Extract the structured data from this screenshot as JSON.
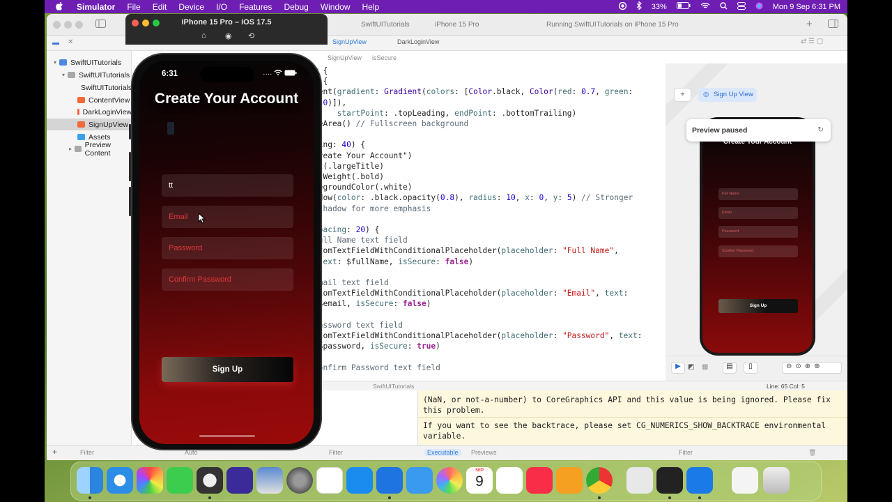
{
  "menubar": {
    "app": "Simulator",
    "items": [
      "File",
      "Edit",
      "Device",
      "I/O",
      "Features",
      "Debug",
      "Window",
      "Help"
    ],
    "battery": "33%",
    "datetime": "Mon 9 Sep  6:31 PM"
  },
  "simulator": {
    "title": "iPhone 15 Pro – iOS 17.5"
  },
  "xcode": {
    "status_project": "SwiftUITutorials",
    "status_device": "iPhone 15 Pro",
    "status_running": "Running SwiftUITutorials on iPhone 15 Pro",
    "tabs": [
      "SignUpView",
      "DarkLoginView"
    ],
    "breadcrumb": [
      "SignUpView",
      "isSecure"
    ],
    "navigator": [
      {
        "label": "SwiftUITutorials",
        "indent": 0
      },
      {
        "label": "SwiftUITutorials",
        "indent": 1
      },
      {
        "label": "SwiftUITutorials",
        "indent": 2
      },
      {
        "label": "ContentView",
        "indent": 2
      },
      {
        "label": "DarkLoginView",
        "indent": 2
      },
      {
        "label": "SignUpView",
        "indent": 2
      },
      {
        "label": "Assets",
        "indent": 2
      },
      {
        "label": "Preview Content",
        "indent": 2
      }
    ],
    "line_col": "Line: 65  Col: 5",
    "debug_target": "SwiftUITutorials",
    "filter_placeholder": "Filter",
    "console_tabs": [
      "Executable",
      "Previews"
    ],
    "zoom_label": "Auto"
  },
  "code_lines": [
    "w {",
    "y {",
    "ient(gradient: Gradient(colors: [Color.black, Color(red: 0.7, green:",
    ": 0)]),",
    "     startPoint: .topLeading, endPoint: .bottomTrailing)",
    "feArea() // Fullscreen background",
    "",
    "cing: 40) {",
    "Create Your Account\")",
    "nt(.largeTitle)",
    "ntWeight(.bold)",
    "regroundColor(.white)",
    "adow(color: .black.opacity(0.8), radius: 10, x: 0, y: 5) // Stronger",
    " shadow for more emphasis",
    ")",
    "spacing: 20) {",
    "Full Name text field",
    "stomTextFieldWithConditionalPlaceholder(placeholder: \"Full Name\",",
    " text: $fullName, isSecure: false)",
    "",
    "Email text field",
    "stomTextFieldWithConditionalPlaceholder(placeholder: \"Email\", text:",
    " $email, isSecure: false)",
    "",
    "Password text field",
    "stomTextFieldWithConditionalPlaceholder(placeholder: \"Password\", text:",
    " $password, isSecure: true)",
    "",
    "Confirm Password text field"
  ],
  "console": {
    "messages": [
      "(NaN, or not-a-number) to CoreGraphics API and this value is being ignored. Please fix\nthis problem.",
      "If you want to see the backtrace, please set CG_NUMERICS_SHOW_BACKTRACE environmental\nvariable."
    ]
  },
  "preview": {
    "badge": "Sign Up View",
    "paused": "Preview paused",
    "title": "Create Your Account",
    "fields": [
      "Full Name",
      "Email",
      "Password",
      "Confirm Password"
    ],
    "button": "Sign Up"
  },
  "app": {
    "time": "6:31",
    "title": "Create Your Account",
    "fullname_value": "tt",
    "email_placeholder": "Email",
    "password_placeholder": "Password",
    "confirm_placeholder": "Confirm Password",
    "button": "Sign Up"
  },
  "dock": {
    "calendar_month": "SEP",
    "calendar_day": "9"
  }
}
